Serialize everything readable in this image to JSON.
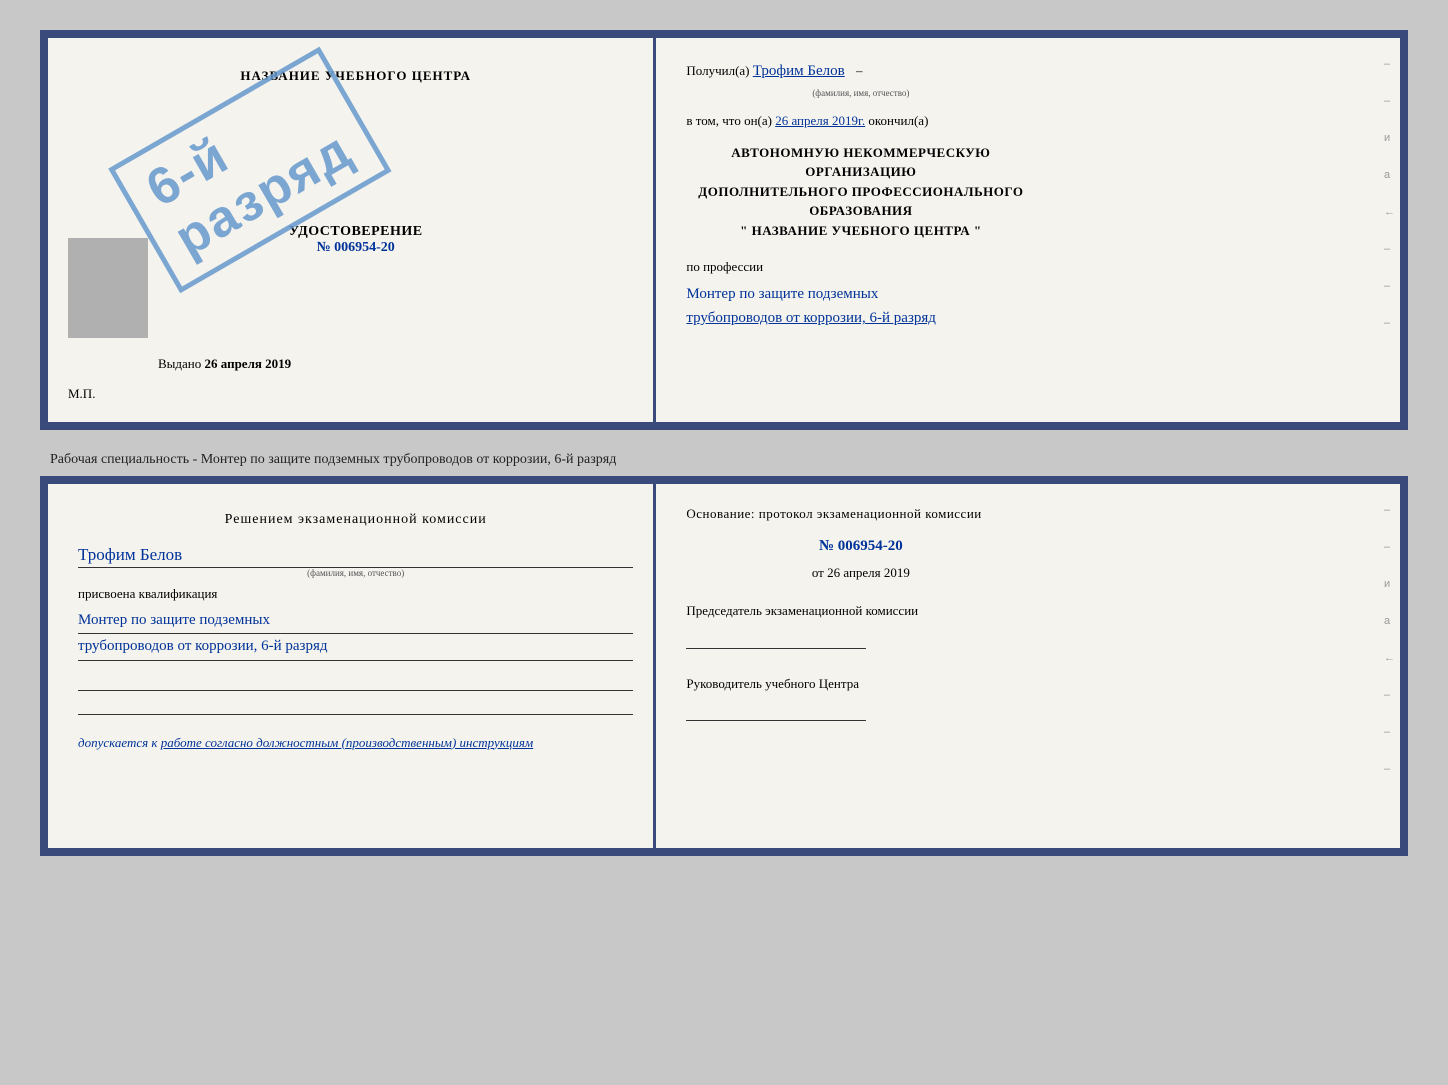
{
  "background_color": "#c8c8c8",
  "border_color": "#3a4a7a",
  "top_certificate": {
    "left": {
      "org_name": "НАЗВАНИЕ УЧЕБНОГО ЦЕНТРА",
      "stamp_line1": "6-й",
      "stamp_line2": "разряд",
      "udostoverenie_label": "УДОСТОВЕРЕНИЕ",
      "number_prefix": "№",
      "number_value": "006954-20",
      "vydano_label": "Выдано",
      "vydano_date": "26 апреля 2019",
      "mp_label": "М.П."
    },
    "right": {
      "poluchil_label": "Получил(а)",
      "fio_value": "Трофим Белов",
      "fio_sub": "(фамилия, имя, отчество)",
      "vtom_label": "в том, что он(а)",
      "date_value": "26 апреля 2019г.",
      "okonchil_label": "окончил(а)",
      "org_line1": "АВТОНОМНУЮ НЕКОММЕРЧЕСКУЮ ОРГАНИЗАЦИЮ",
      "org_line2": "ДОПОЛНИТЕЛЬНОГО ПРОФЕССИОНАЛЬНОГО ОБРАЗОВАНИЯ",
      "org_line3": "\"   НАЗВАНИЕ УЧЕБНОГО ЦЕНТРА   \"",
      "po_professii": "по профессии",
      "profession_line1": "Монтер по защите подземных",
      "profession_line2": "трубопроводов от коррозии, 6-й разряд"
    }
  },
  "separator": {
    "text": "Рабочая специальность - Монтер по защите подземных трубопроводов от коррозии, 6-й разряд"
  },
  "bottom_certificate": {
    "left": {
      "resheniem_label": "Решением экзаменационной комиссии",
      "fio_value": "Трофим Белов",
      "fio_sub": "(фамилия, имя, отчество)",
      "prisvoena_label": "присвоена квалификация",
      "qualification_line1": "Монтер по защите подземных",
      "qualification_line2": "трубопроводов от коррозии, 6-й разряд",
      "dopuskaetsya_prefix": "допускается к",
      "dopuskaetsya_value": "работе согласно должностным (производственным) инструкциям"
    },
    "right": {
      "osnovanie_label": "Основание: протокол экзаменационной комиссии",
      "number_prefix": "№",
      "number_value": "006954-20",
      "ot_prefix": "от",
      "ot_date": "26 апреля 2019",
      "predsedatel_label": "Председатель экзаменационной комиссии",
      "rukovoditel_label": "Руководитель учебного Центра"
    }
  },
  "decorative_chars": [
    "–",
    "–",
    "и",
    "а",
    "←",
    "–",
    "–",
    "–"
  ]
}
